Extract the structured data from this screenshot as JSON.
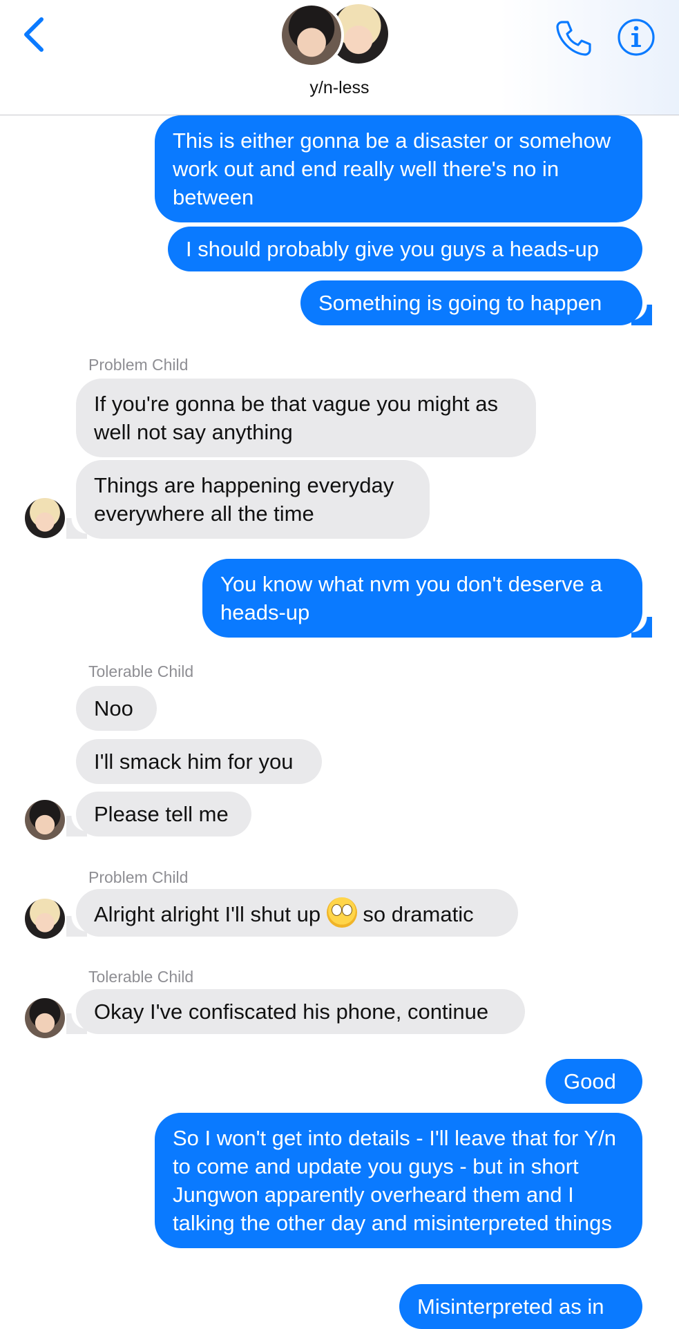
{
  "header": {
    "title": "y/n-less",
    "back_icon": "chevron-left-icon",
    "phone_icon": "phone-icon",
    "info_icon": "info-icon",
    "accent_color": "#0a7aff"
  },
  "messages": [
    {
      "direction": "outgoing",
      "text": "This is either gonna be a disaster or somehow work out and end really well there's no in between"
    },
    {
      "direction": "outgoing",
      "text": "I should probably give you guys a heads-up"
    },
    {
      "direction": "outgoing",
      "text": "Something is going to happen"
    },
    {
      "direction": "sender",
      "text": "Problem Child"
    },
    {
      "direction": "incoming",
      "text": "If you're gonna be that vague you might as well not say anything"
    },
    {
      "direction": "incoming",
      "text": "Things are happening everyday everywhere all the time"
    },
    {
      "direction": "outgoing",
      "text": "You know what nvm you don't deserve a heads-up"
    },
    {
      "direction": "sender",
      "text": "Tolerable Child"
    },
    {
      "direction": "incoming",
      "text": "Noo"
    },
    {
      "direction": "incoming",
      "text": "I'll smack him for you"
    },
    {
      "direction": "incoming",
      "text": "Please tell me"
    },
    {
      "direction": "sender",
      "text": "Problem Child"
    },
    {
      "direction": "incoming",
      "text_before_emoji": "Alright alright I'll shut up",
      "emoji": "eye-roll-emoji",
      "text_after_emoji": "so dramatic"
    },
    {
      "direction": "sender",
      "text": "Tolerable Child"
    },
    {
      "direction": "incoming",
      "text": "Okay I've confiscated his phone, continue"
    },
    {
      "direction": "outgoing",
      "text": "Good"
    },
    {
      "direction": "outgoing",
      "text": "So I won't get into details - I'll leave that for Y/n to come and update you guys - but in short Jungwon apparently overheard them and I talking the other day and misinterpreted things"
    },
    {
      "direction": "outgoing",
      "text": "Misinterpreted as in"
    }
  ],
  "colors": {
    "outgoing_bubble": "#0a7aff",
    "incoming_bubble": "#e9e9eb",
    "sender_label": "#8e8e93"
  }
}
